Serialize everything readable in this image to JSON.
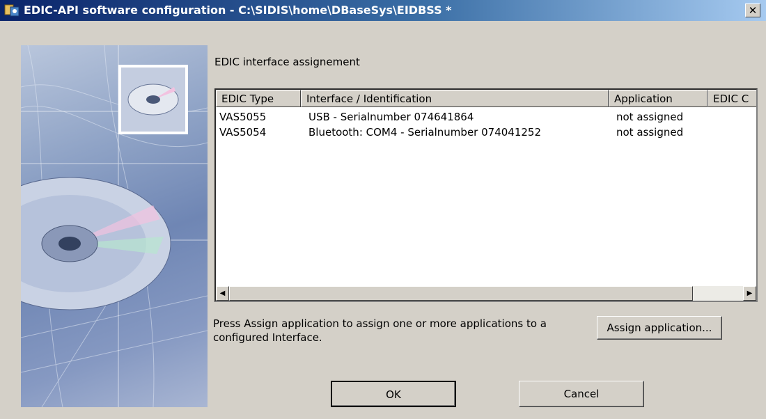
{
  "window": {
    "title": "EDIC-API software configuration - C:\\SIDIS\\home\\DBaseSys\\EIDBSS *",
    "close_label": "✕",
    "icon": "app-config-icon"
  },
  "section_label": "EDIC interface assignement",
  "list": {
    "columns": [
      "EDIC Type",
      "Interface / Identification",
      "Application",
      "EDIC C"
    ],
    "rows": [
      {
        "type": "VAS5055",
        "interface": "USB - Serialnumber 074641864",
        "application": "not assigned"
      },
      {
        "type": "VAS5054",
        "interface": "Bluetooth: COM4 - Serialnumber 074041252",
        "application": "not assigned"
      }
    ],
    "scroll_left_icon": "◀",
    "scroll_right_icon": "▶"
  },
  "hint_text": "Press Assign application to assign one or more applications to a configured Interface.",
  "buttons": {
    "assign": "Assign application...",
    "ok": "OK",
    "cancel": "Cancel"
  }
}
